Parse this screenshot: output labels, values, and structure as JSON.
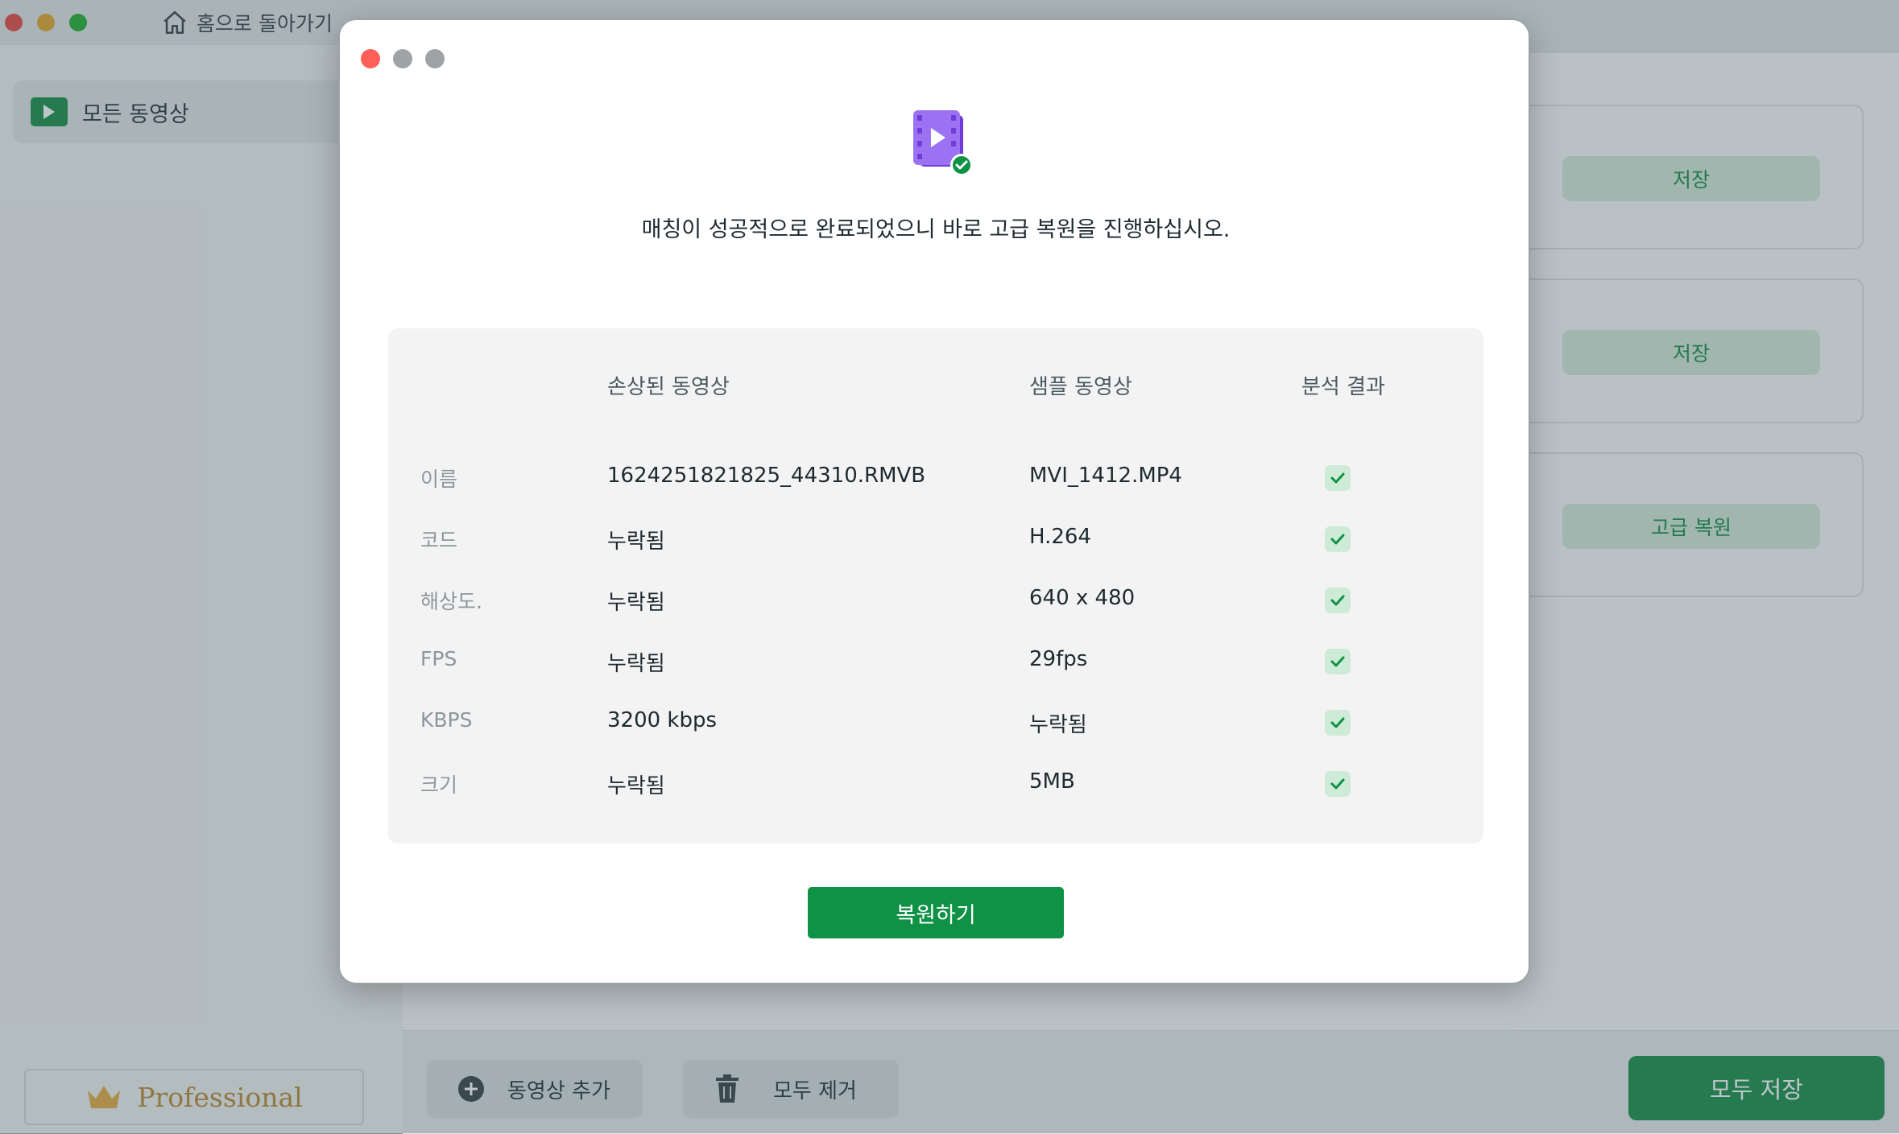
{
  "app": {
    "home_link": "홈으로 돌아가기",
    "sidebar": {
      "item_label": "모든 동영상"
    },
    "pro_label": "Professional",
    "cards": [
      {
        "button": "저장"
      },
      {
        "button": "저장"
      },
      {
        "button": "고급 복원"
      }
    ],
    "bottom": {
      "add_video": "동영상 추가",
      "remove_all": "모두 제거",
      "save_all": "모두 저장"
    }
  },
  "modal": {
    "message": "매칭이 성공적으로 완료되었으니 바로 고급 복원을 진행하십시오.",
    "columns": {
      "damaged": "손상된 동영상",
      "sample": "샘플 동영상",
      "result": "분석 결과"
    },
    "rows": [
      {
        "label": "이름",
        "damaged": "1624251821825_44310.RMVB",
        "sample": "MVI_1412.MP4"
      },
      {
        "label": "코드",
        "damaged": "누락됨",
        "sample": "H.264"
      },
      {
        "label": "해상도.",
        "damaged": "누락됨",
        "sample": "640 x 480"
      },
      {
        "label": "FPS",
        "damaged": "누락됨",
        "sample": "29fps"
      },
      {
        "label": "KBPS",
        "damaged": "3200 kbps",
        "sample": "누락됨"
      },
      {
        "label": "크기",
        "damaged": "누락됨",
        "sample": "5MB"
      }
    ],
    "restore_button": "복원하기"
  },
  "icons": {
    "home": "home-icon",
    "play": "play-icon",
    "crown": "crown-icon",
    "add": "plus-circle-icon",
    "trash": "trash-icon",
    "video_check": "video-check-icon",
    "check": "check-icon"
  },
  "colors": {
    "accent_green": "#0f8a40",
    "check_bg": "#cdebd7",
    "pro_gold": "#b8832b",
    "close_red": "#ff5f57"
  }
}
